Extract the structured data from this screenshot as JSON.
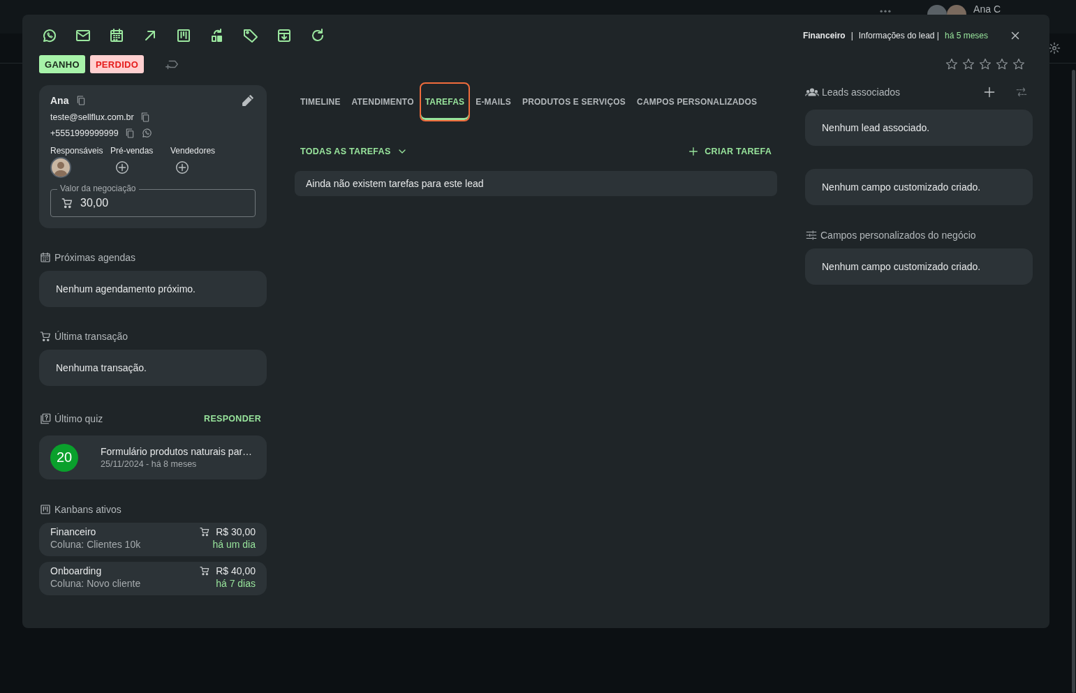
{
  "background": {
    "user_name": "Ana C"
  },
  "header": {
    "pipeline": "Financeiro",
    "separator": "|",
    "info": "Informações do lead |",
    "age": "há 5 meses"
  },
  "status_buttons": [
    {
      "label": "GANHO",
      "kind": "won"
    },
    {
      "label": "PERDIDO",
      "kind": "lost"
    }
  ],
  "rating": {
    "stars": 0
  },
  "contact": {
    "name": "Ana",
    "email": "teste@sellflux.com.br",
    "phone": "+5551999999999",
    "roles": [
      {
        "label": "Responsáveis",
        "kind": "avatar"
      },
      {
        "label": "Pré-vendas",
        "kind": "add"
      },
      {
        "label": "Vendedores",
        "kind": "add"
      }
    ],
    "deal_value": {
      "label": "Valor da negociação",
      "value": "30,00"
    }
  },
  "schedule": {
    "title": "Próximas agendas",
    "empty": "Nenhum agendamento próximo."
  },
  "transaction": {
    "title": "Última transação",
    "empty": "Nenhuma transação."
  },
  "quiz": {
    "title": "Último quiz",
    "action": "RESPONDER",
    "score": "20",
    "name": "Formulário produtos naturais par…",
    "date": "25/11/2024 - há 8 meses"
  },
  "kanbans": {
    "title": "Kanbans ativos",
    "items": [
      {
        "name": "Financeiro",
        "column": "Coluna: Clientes 10k",
        "value": "R$ 30,00",
        "age": "há um dia"
      },
      {
        "name": "Onboarding",
        "column": "Coluna: Novo cliente",
        "value": "R$ 40,00",
        "age": "há 7 dias"
      }
    ]
  },
  "tabs": [
    {
      "label": "TIMELINE",
      "selected": false
    },
    {
      "label": "ATENDIMENTO",
      "selected": false
    },
    {
      "label": "TAREFAS",
      "selected": true
    },
    {
      "label": "E-MAILS",
      "selected": false
    },
    {
      "label": "PRODUTOS E SERVIÇOS",
      "selected": false
    },
    {
      "label": "CAMPOS PERSONALIZADOS",
      "selected": false
    }
  ],
  "tasks": {
    "filter": "TODAS AS TAREFAS",
    "create": "CRIAR TAREFA",
    "empty": "Ainda não existem tarefas para este lead"
  },
  "associated_leads": {
    "title": "Leads associados",
    "empty": "Nenhum lead associado.",
    "custom_fields_empty": "Nenhum campo customizado criado."
  },
  "business_fields": {
    "title": "Campos personalizados do negócio",
    "empty": "Nenhum campo customizado criado."
  }
}
